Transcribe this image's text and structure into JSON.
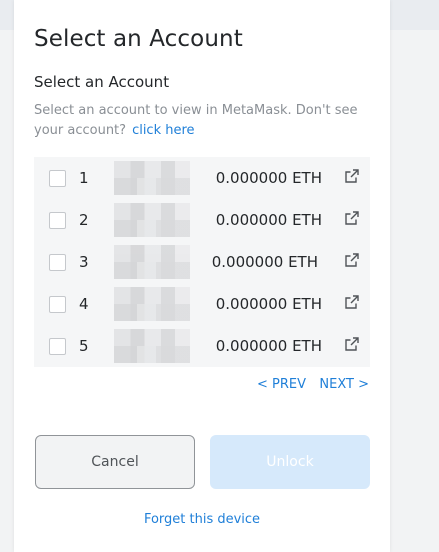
{
  "modal": {
    "title": "Select an Account",
    "subtitle": "Select an Account",
    "description": "Select an account to view in MetaMask. Don't see your account?",
    "description_link": "click here"
  },
  "accounts": [
    {
      "index": "1",
      "balance": "0.000000 ETH"
    },
    {
      "index": "2",
      "balance": "0.000000 ETH"
    },
    {
      "index": "3",
      "balance": "0.000000 ETH"
    },
    {
      "index": "4",
      "balance": "0.000000 ETH"
    },
    {
      "index": "5",
      "balance": "0.000000 ETH"
    }
  ],
  "pagination": {
    "prev_label": "< PREV",
    "next_label": "NEXT >"
  },
  "buttons": {
    "cancel_label": "Cancel",
    "unlock_label": "Unlock"
  },
  "footer": {
    "forget_label": "Forget this device"
  },
  "icons": {
    "external_link": "external-link-icon",
    "checkbox": "checkbox"
  },
  "colors": {
    "link": "#1f7fd8",
    "unlock_disabled": "#d6e9fb",
    "text": "#24272a"
  }
}
